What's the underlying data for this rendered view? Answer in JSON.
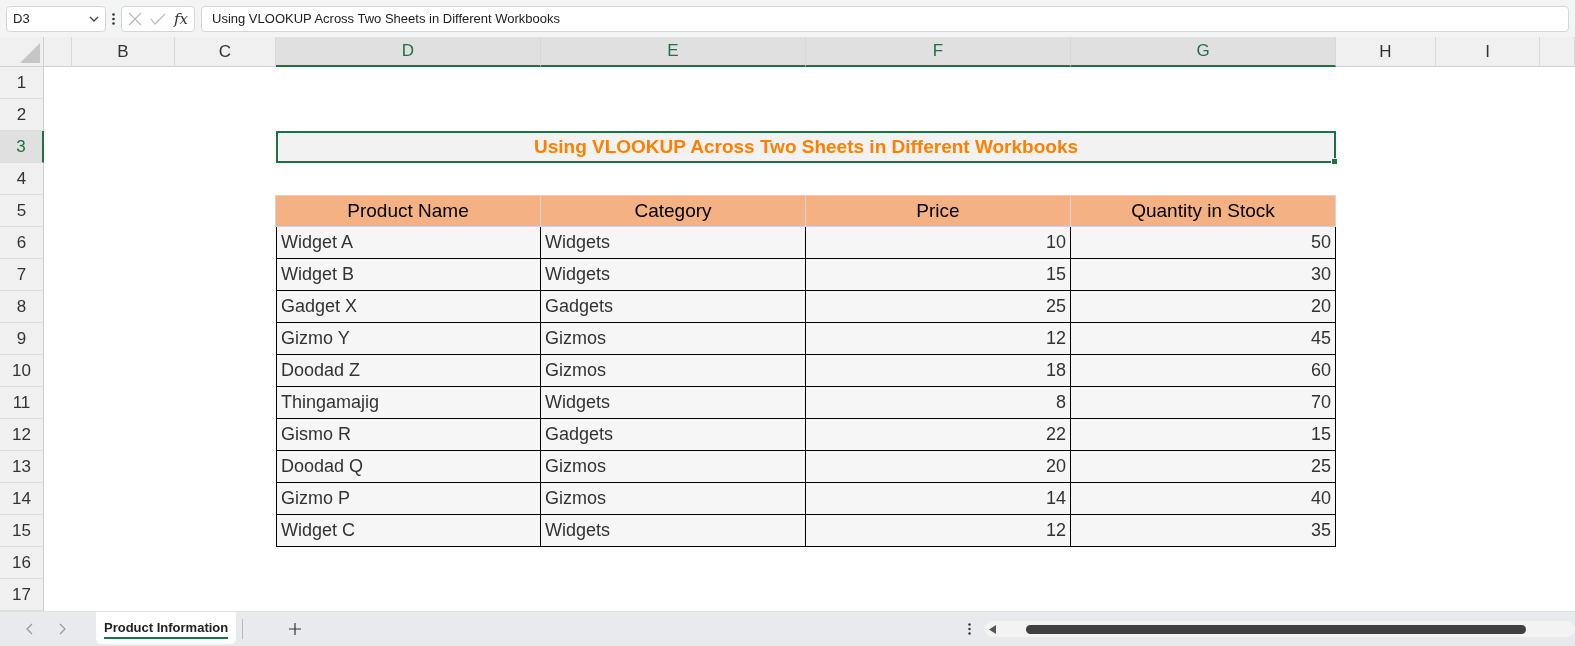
{
  "formula_bar": {
    "name_box": "D3",
    "function_label": "fx",
    "formula": "Using VLOOKUP Across Two Sheets in Different Workbooks"
  },
  "columns": [
    {
      "label": "B",
      "selected": false
    },
    {
      "label": "C",
      "selected": false
    },
    {
      "label": "D",
      "selected": true
    },
    {
      "label": "E",
      "selected": true
    },
    {
      "label": "F",
      "selected": true
    },
    {
      "label": "G",
      "selected": true
    },
    {
      "label": "H",
      "selected": false
    },
    {
      "label": "I",
      "selected": false
    }
  ],
  "rows": [
    {
      "label": "1",
      "selected": false
    },
    {
      "label": "2",
      "selected": false
    },
    {
      "label": "3",
      "selected": true
    },
    {
      "label": "4",
      "selected": false
    },
    {
      "label": "5",
      "selected": false
    },
    {
      "label": "6",
      "selected": false
    },
    {
      "label": "7",
      "selected": false
    },
    {
      "label": "8",
      "selected": false
    },
    {
      "label": "9",
      "selected": false
    },
    {
      "label": "10",
      "selected": false
    },
    {
      "label": "11",
      "selected": false
    },
    {
      "label": "12",
      "selected": false
    },
    {
      "label": "13",
      "selected": false
    },
    {
      "label": "14",
      "selected": false
    },
    {
      "label": "15",
      "selected": false
    },
    {
      "label": "16",
      "selected": false
    },
    {
      "label": "17",
      "selected": false
    }
  ],
  "title": "Using VLOOKUP Across Two Sheets in Different Workbooks",
  "table": {
    "columns": [
      {
        "label": "Product Name",
        "kind": "text"
      },
      {
        "label": "Category",
        "kind": "text"
      },
      {
        "label": "Price",
        "kind": "number"
      },
      {
        "label": "Quantity in Stock",
        "kind": "number"
      }
    ],
    "rows": [
      [
        "Widget A",
        "Widgets",
        "10",
        "50"
      ],
      [
        "Widget B",
        "Widgets",
        "15",
        "30"
      ],
      [
        "Gadget X",
        "Gadgets",
        "25",
        "20"
      ],
      [
        "Gizmo Y",
        "Gizmos",
        "12",
        "45"
      ],
      [
        "Doodad Z",
        "Gizmos",
        "18",
        "60"
      ],
      [
        "Thingamajig",
        "Widgets",
        "8",
        "70"
      ],
      [
        "Gismo R",
        "Gadgets",
        "22",
        "15"
      ],
      [
        "Doodad Q",
        "Gizmos",
        "20",
        "25"
      ],
      [
        "Gizmo P",
        "Gizmos",
        "14",
        "40"
      ],
      [
        "Widget C",
        "Widgets",
        "12",
        "35"
      ]
    ]
  },
  "sheet_tabs": [
    {
      "label": "Product Information",
      "selected": true
    }
  ]
}
